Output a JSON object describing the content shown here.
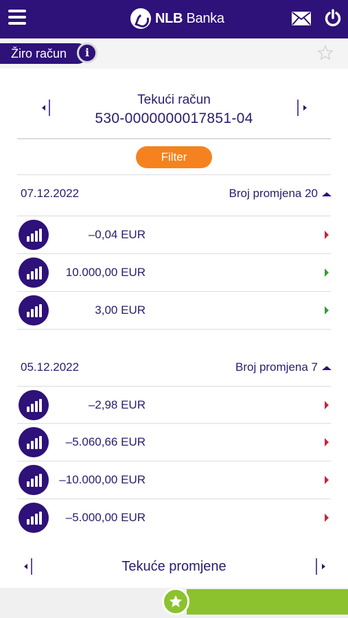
{
  "header": {
    "brand_name": "NLB",
    "brand_suffix": " Banka",
    "icons": [
      "menu-icon",
      "mail-icon",
      "power-icon"
    ]
  },
  "account_tab": {
    "label": "Žiro račun",
    "info": "i"
  },
  "account": {
    "type": "Tekući račun",
    "number": "530-0000000017851-04"
  },
  "filter_label": "Filter",
  "groups": [
    {
      "date": "07.12.2022",
      "count_label": "Broj promjena 20",
      "transactions": [
        {
          "amount": "–0,04 EUR",
          "direction": "red"
        },
        {
          "amount": "10.000,00 EUR",
          "direction": "green"
        },
        {
          "amount": "3,00 EUR",
          "direction": "green"
        }
      ]
    },
    {
      "date": "05.12.2022",
      "count_label": "Broj promjena 7",
      "transactions": [
        {
          "amount": "–2,98 EUR",
          "direction": "red"
        },
        {
          "amount": "–5.060,66 EUR",
          "direction": "red"
        },
        {
          "amount": "–10.000,00 EUR",
          "direction": "red"
        },
        {
          "amount": "–5.000,00 EUR",
          "direction": "red"
        }
      ]
    }
  ],
  "footer": {
    "title": "Tekuće promjene"
  },
  "colors": {
    "brand": "#2e1179",
    "accent": "#f5821f",
    "success": "#8cc22d",
    "debit_arrow": "#c0283c",
    "credit_arrow": "#3a9a3a"
  }
}
